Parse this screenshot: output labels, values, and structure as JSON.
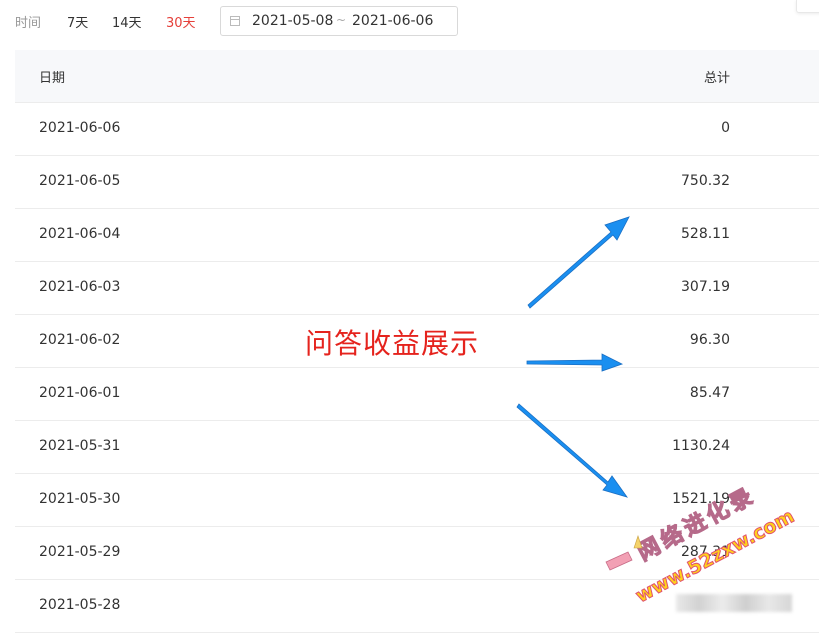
{
  "filter": {
    "label": "时间",
    "ranges": [
      "7天",
      "14天",
      "30天"
    ],
    "active_range": "30天",
    "start_date": "2021-05-08",
    "separator": "~",
    "end_date": "2021-06-06"
  },
  "table": {
    "columns": [
      "日期",
      "总计"
    ],
    "rows": [
      {
        "date": "2021-06-06",
        "total": "0"
      },
      {
        "date": "2021-06-05",
        "total": "750.32"
      },
      {
        "date": "2021-06-04",
        "total": "528.11"
      },
      {
        "date": "2021-06-03",
        "total": "307.19"
      },
      {
        "date": "2021-06-02",
        "total": "96.30"
      },
      {
        "date": "2021-06-01",
        "total": "85.47"
      },
      {
        "date": "2021-05-31",
        "total": "1130.24"
      },
      {
        "date": "2021-05-30",
        "total": "1521.19"
      },
      {
        "date": "2021-05-29",
        "total": "287.31"
      },
      {
        "date": "2021-05-28",
        "total": ""
      }
    ]
  },
  "annotation": {
    "text": "问答收益展示"
  },
  "watermark": {
    "line1": "网络进化录",
    "line2": "www.52zxw.com"
  },
  "colors": {
    "active_tab": "#e5403a",
    "annotation": "#e5231d",
    "arrow": "#1a8ff0"
  }
}
